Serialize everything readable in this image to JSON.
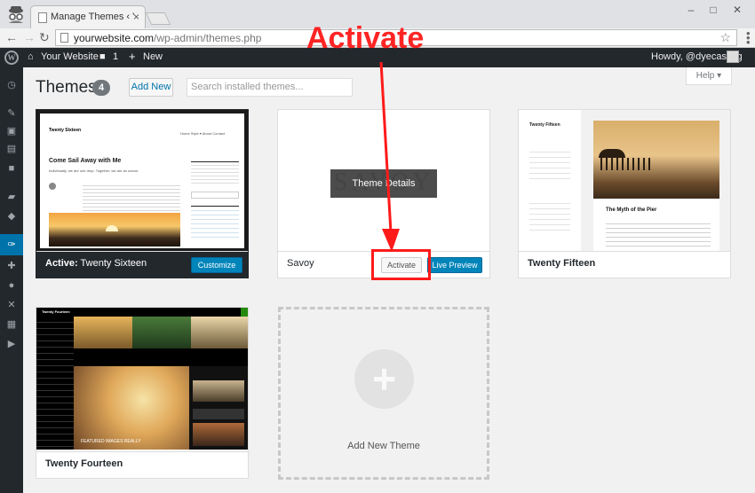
{
  "browser": {
    "tab_title": "Manage Themes ‹ Your W",
    "tab_close": "×",
    "url_host": "yourwebsite.com",
    "url_path": "/wp-admin/themes.php",
    "win_min": "–",
    "win_max": "□",
    "win_close": "✕"
  },
  "adminbar": {
    "site_name": "Your Website",
    "comments_count": "1",
    "new_label": "New",
    "howdy": "Howdy, @dyecasting"
  },
  "page": {
    "title": "Themes",
    "count": "4",
    "add_new": "Add New",
    "search_placeholder": "Search installed themes...",
    "help": "Help"
  },
  "annotation": {
    "text": "Activate"
  },
  "themes": [
    {
      "name": "Twenty Sixteen",
      "active_prefix": "Active:",
      "active_name": "Twenty Sixteen",
      "customize": "Customize",
      "preview": {
        "site_title": "Twenty Sixteen",
        "headline": "Come Sail Away with Me",
        "tagline": "Individually, we are one drop. Together, we are an ocean."
      }
    },
    {
      "name": "Savoy",
      "overlay": "Theme Details",
      "ghost": "SAVOY",
      "activate": "Activate",
      "live_preview": "Live Preview"
    },
    {
      "name": "Twenty Fifteen",
      "preview": {
        "site_title": "Twenty Fifteen",
        "headline": "The Myth of the Pier"
      }
    },
    {
      "name": "Twenty Fourteen",
      "preview": {
        "site_title": "Twenty Fourteen",
        "caption": "FEATURED IMAGES REALLY"
      }
    }
  ],
  "add_new_theme": {
    "label": "Add New Theme"
  }
}
